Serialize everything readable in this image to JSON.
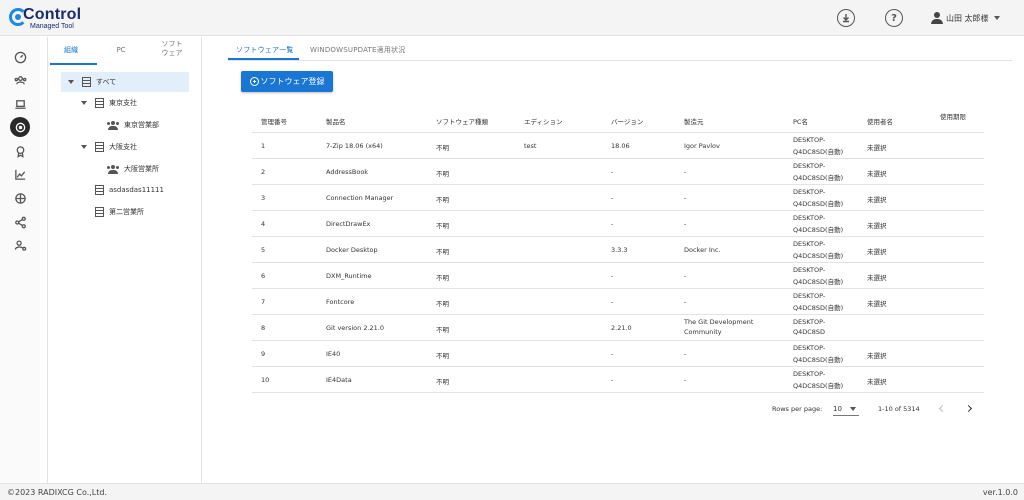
{
  "header": {
    "logo_title": "Control",
    "logo_subtitle": "Managed Tool",
    "user_name": "山田 太郎様"
  },
  "tree": {
    "tabs": [
      {
        "label": "組織"
      },
      {
        "label": "PC"
      },
      {
        "label": "ソフト\nウェア"
      }
    ],
    "nodes": [
      {
        "label": "すべて",
        "icon": "building-icon"
      },
      {
        "label": "東京支社",
        "icon": "building-icon"
      },
      {
        "label": "東京営業部",
        "icon": "group-icon"
      },
      {
        "label": "大阪支社",
        "icon": "building-icon"
      },
      {
        "label": "大阪営業所",
        "icon": "group-icon"
      },
      {
        "label": "asdasdas11111",
        "icon": "building-icon"
      },
      {
        "label": "第二営業所",
        "icon": "building-icon"
      }
    ]
  },
  "main": {
    "tabs": [
      {
        "label": "ソフトウェア一覧"
      },
      {
        "label": "WINDOWSUPDATE適用状況"
      }
    ],
    "register_label": "ソフトウェア登録",
    "columns": [
      "管理番号",
      "製品名",
      "ソフトウェア種類",
      "エディション",
      "バージョン",
      "製造元",
      "PC名",
      "使用者名",
      "使用期限"
    ],
    "rows": [
      {
        "id": "1",
        "name": "7-Zip 18.06 (x64)",
        "type": "不明",
        "edition": "test",
        "version": "18.06",
        "maker": "Igor Pavlov",
        "pc1": "DESKTOP-",
        "pc2": "Q4DC8SD(自動)",
        "user": "未選択",
        "expiry": ""
      },
      {
        "id": "2",
        "name": "AddressBook",
        "type": "不明",
        "edition": "",
        "version": "-",
        "maker": "-",
        "pc1": "DESKTOP-",
        "pc2": "Q4DC8SD(自動)",
        "user": "未選択",
        "expiry": ""
      },
      {
        "id": "3",
        "name": "Connection Manager",
        "type": "不明",
        "edition": "",
        "version": "-",
        "maker": "-",
        "pc1": "DESKTOP-",
        "pc2": "Q4DC8SD(自動)",
        "user": "未選択",
        "expiry": ""
      },
      {
        "id": "4",
        "name": "DirectDrawEx",
        "type": "不明",
        "edition": "",
        "version": "-",
        "maker": "-",
        "pc1": "DESKTOP-",
        "pc2": "Q4DC8SD(自動)",
        "user": "未選択",
        "expiry": ""
      },
      {
        "id": "5",
        "name": "Docker Desktop",
        "type": "不明",
        "edition": "",
        "version": "3.3.3",
        "maker": "Docker Inc.",
        "pc1": "DESKTOP-",
        "pc2": "Q4DC8SD(自動)",
        "user": "未選択",
        "expiry": ""
      },
      {
        "id": "6",
        "name": "DXM_Runtime",
        "type": "不明",
        "edition": "",
        "version": "-",
        "maker": "-",
        "pc1": "DESKTOP-",
        "pc2": "Q4DC8SD(自動)",
        "user": "未選択",
        "expiry": ""
      },
      {
        "id": "7",
        "name": "Fontcore",
        "type": "不明",
        "edition": "",
        "version": "-",
        "maker": "-",
        "pc1": "DESKTOP-",
        "pc2": "Q4DC8SD(自動)",
        "user": "未選択",
        "expiry": ""
      },
      {
        "id": "8",
        "name": "Git version 2.21.0",
        "type": "不明",
        "edition": "",
        "version": "2.21.0",
        "maker": "The Git Development Community",
        "maker1": "The Git Development",
        "maker2": "Community",
        "pc1": "DESKTOP-",
        "pc2": "Q4DC8SD",
        "user": "",
        "expiry": ""
      },
      {
        "id": "9",
        "name": "IE40",
        "type": "不明",
        "edition": "",
        "version": "-",
        "maker": "-",
        "pc1": "DESKTOP-",
        "pc2": "Q4DC8SD(自動)",
        "user": "未選択",
        "expiry": ""
      },
      {
        "id": "10",
        "name": "IE4Data",
        "type": "不明",
        "edition": "",
        "version": "-",
        "maker": "-",
        "pc1": "DESKTOP-",
        "pc2": "Q4DC8SD(自動)",
        "user": "未選択",
        "expiry": ""
      }
    ],
    "pagination": {
      "rows_per_page_label": "Rows per page:",
      "rows_per_page": "10",
      "range": "1-10 of 5314"
    }
  },
  "rail": [
    "speedometer-icon",
    "users-icon",
    "laptop-icon",
    "disc-icon",
    "badge-icon",
    "chart-icon",
    "globe-icon",
    "share-icon",
    "user-settings-icon"
  ],
  "footer": {
    "copyright": "©2023 RADIXCG Co.,Ltd.",
    "version": "ver.1.0.0"
  },
  "colors": {
    "accent": "#1976d2",
    "selected_bg": "#e3eefb"
  }
}
